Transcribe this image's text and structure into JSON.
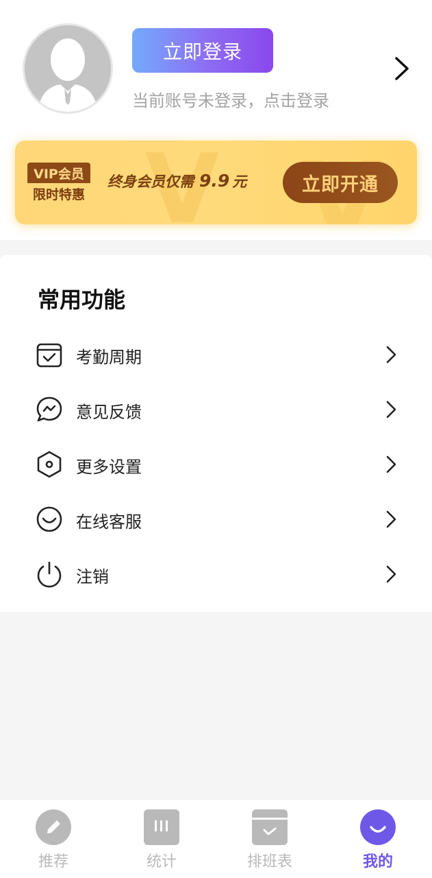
{
  "profile": {
    "login_button": "立即登录",
    "login_hint": "当前账号未登录，点击登录"
  },
  "vip": {
    "tag_top": "VIP会员",
    "tag_bottom": "限时特惠",
    "text": "终身会员仅需",
    "price": "9.9",
    "unit": "元",
    "button": "立即开通",
    "accent_color": "#ffd779"
  },
  "functions": {
    "title": "常用功能",
    "items": [
      {
        "label": "考勤周期",
        "icon": "calendar-check-icon"
      },
      {
        "label": "意见反馈",
        "icon": "chat-bubble-icon"
      },
      {
        "label": "更多设置",
        "icon": "hexagon-settings-icon"
      },
      {
        "label": "在线客服",
        "icon": "smile-icon"
      },
      {
        "label": "注销",
        "icon": "power-icon"
      }
    ]
  },
  "tabbar": {
    "items": [
      {
        "label": "推荐",
        "icon": "pencil-icon"
      },
      {
        "label": "统计",
        "icon": "bars-icon"
      },
      {
        "label": "排班表",
        "icon": "schedule-icon"
      },
      {
        "label": "我的",
        "icon": "smile-face-icon",
        "active": true
      }
    ],
    "active_color": "#6e58e8",
    "inactive_color": "#b9b9b9"
  }
}
